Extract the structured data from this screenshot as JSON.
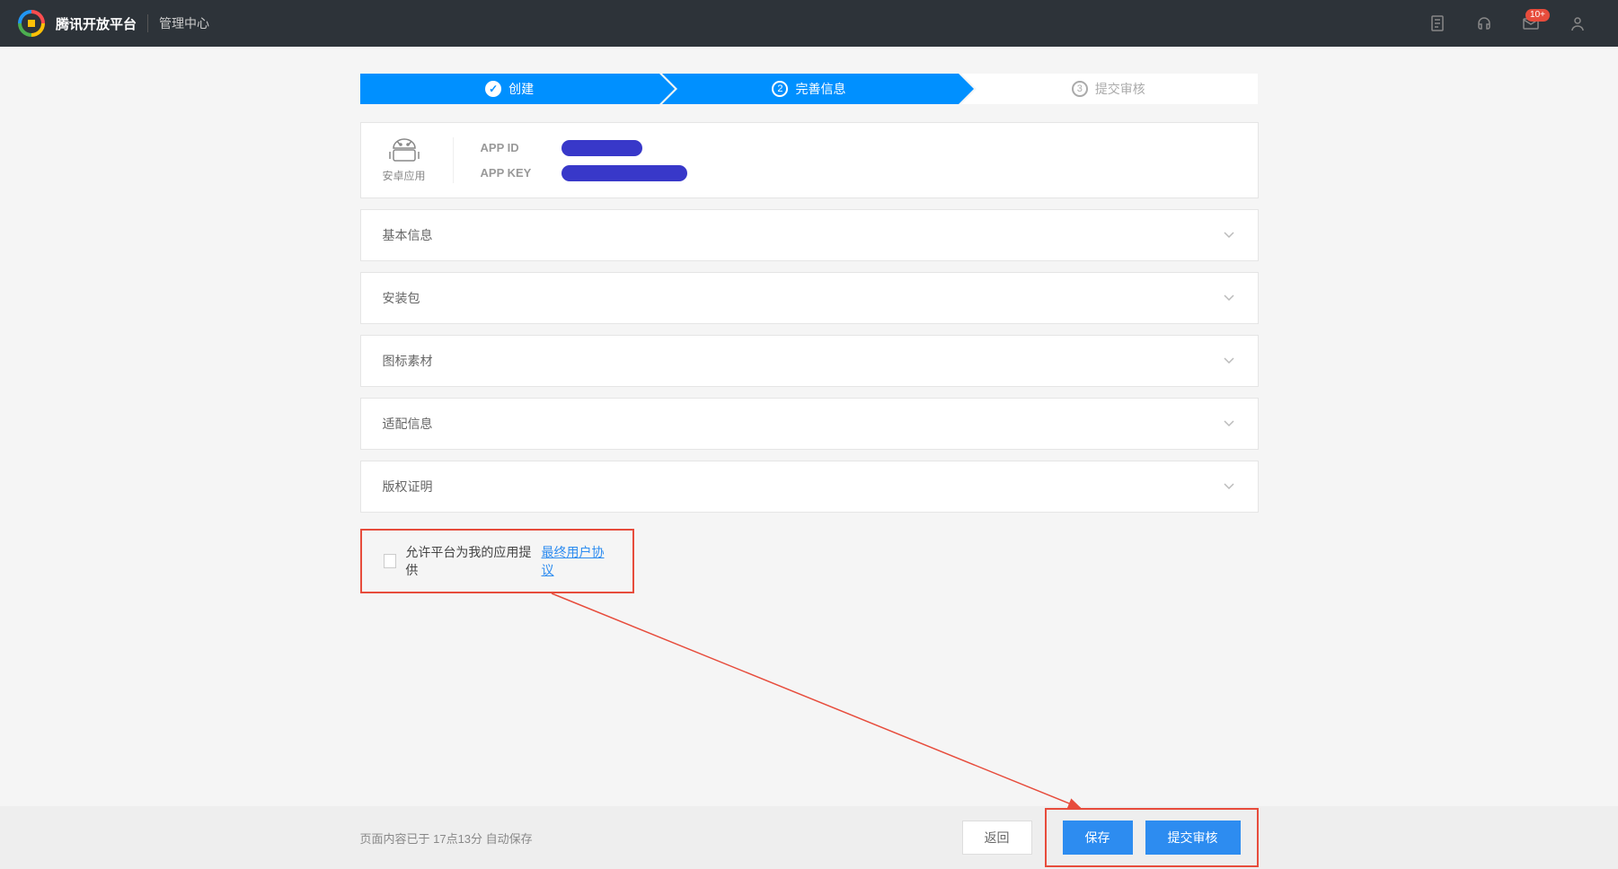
{
  "header": {
    "title": "腾讯开放平台",
    "subtitle": "管理中心",
    "badge_count": "10+"
  },
  "steps": [
    {
      "label": "创建",
      "state": "done"
    },
    {
      "label": "完善信息",
      "state": "active",
      "num": "2"
    },
    {
      "label": "提交审核",
      "state": "pending",
      "num": "3"
    }
  ],
  "app": {
    "type_label": "安卓应用",
    "id_label": "APP ID",
    "key_label": "APP KEY"
  },
  "panels": [
    {
      "title": "基本信息"
    },
    {
      "title": "安装包"
    },
    {
      "title": "图标素材"
    },
    {
      "title": "适配信息"
    },
    {
      "title": "版权证明"
    }
  ],
  "agreement": {
    "prefix": "允许平台为我的应用提供",
    "link": "最终用户协议"
  },
  "footer": {
    "status": "页面内容已于 17点13分 自动保存",
    "back": "返回",
    "save": "保存",
    "submit": "提交审核"
  }
}
